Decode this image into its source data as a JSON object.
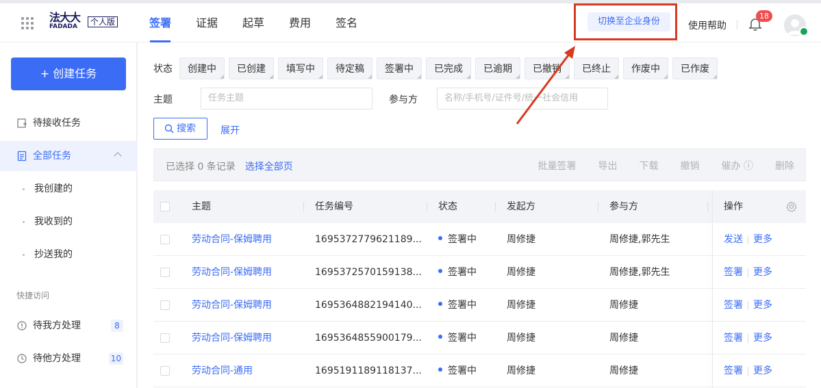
{
  "header": {
    "logo_cn": "法大大",
    "logo_en": "FADADA",
    "version_badge": "个人版",
    "nav": [
      {
        "label": "签署",
        "active": true
      },
      {
        "label": "证据"
      },
      {
        "label": "起草"
      },
      {
        "label": "费用"
      },
      {
        "label": "签名"
      }
    ],
    "switch_label": "切换至企业身份",
    "help_label": "使用帮助",
    "notifications_count": "18"
  },
  "sidebar": {
    "create_label": "+ 创建任务",
    "pending_label": "待接收任务",
    "all_label": "全部任务",
    "sub_items": [
      "我创建的",
      "我收到的",
      "抄送我的"
    ],
    "quick_access_label": "快捷访问",
    "quick_items": [
      {
        "label": "待我方处理",
        "count": "8"
      },
      {
        "label": "待他方处理",
        "count": "10"
      }
    ]
  },
  "filters": {
    "status_label": "状态",
    "statuses": [
      "创建中",
      "已创建",
      "填写中",
      "待定稿",
      "签署中",
      "已完成",
      "已逾期",
      "已撤销",
      "已终止",
      "作废中",
      "已作废"
    ],
    "subject_label": "主题",
    "subject_placeholder": "任务主题",
    "party_label": "参与方",
    "party_placeholder": "名称/手机号/证件号/统一社会信用",
    "search_label": "搜索",
    "expand_label": "展开"
  },
  "batch": {
    "selected_text": "已选择 0 条记录",
    "select_all_label": "选择全部页",
    "actions": [
      "批量签署",
      "导出",
      "下载",
      "撤销",
      "催办 ⓘ",
      "删除"
    ]
  },
  "table": {
    "columns": [
      "主题",
      "任务编号",
      "状态",
      "发起方",
      "参与方",
      "操作"
    ],
    "rows": [
      {
        "subject": "劳动合同-保姆聘用",
        "id": "1695372779621189...",
        "status": "签署中",
        "initiator": "周修捷",
        "parties": "周修捷,郭先生",
        "op1": "发送",
        "op2": "更多"
      },
      {
        "subject": "劳动合同-保姆聘用",
        "id": "1695372570159138...",
        "status": "签署中",
        "initiator": "周修捷",
        "parties": "周修捷,郭先生",
        "op1": "签署",
        "op2": "更多"
      },
      {
        "subject": "劳动合同-保姆聘用",
        "id": "1695364882194140...",
        "status": "签署中",
        "initiator": "周修捷",
        "parties": "周修捷",
        "op1": "签署",
        "op2": "更多"
      },
      {
        "subject": "劳动合同-保姆聘用",
        "id": "1695364855900179...",
        "status": "签署中",
        "initiator": "周修捷",
        "parties": "周修捷",
        "op1": "签署",
        "op2": "更多"
      },
      {
        "subject": "劳动合同-通用",
        "id": "1695191189118137...",
        "status": "签署中",
        "initiator": "周修捷",
        "parties": "周修捷",
        "op1": "签署",
        "op2": "更多"
      }
    ]
  },
  "colors": {
    "accent": "#3a6cf6",
    "highlight": "#d63a20",
    "badge": "#f14d4d"
  }
}
